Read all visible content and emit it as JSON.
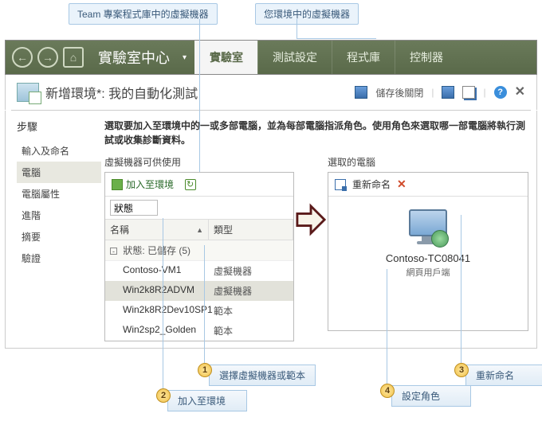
{
  "top_callouts": {
    "left": "Team 專案程式庫中的虛擬機器",
    "right": "您環境中的虛擬機器"
  },
  "ribbon": {
    "title": "實驗室中心",
    "tabs": [
      "實驗室",
      "測試設定",
      "程式庫",
      "控制器"
    ],
    "active_index": 0
  },
  "subheader": {
    "title": "新增環境*: 我的自動化測試",
    "save_close": "儲存後關閉",
    "help_glyph": "?",
    "close_glyph": "✕"
  },
  "steps": {
    "title": "步驟",
    "items": [
      "輸入及命名",
      "電腦",
      "電腦屬性",
      "進階",
      "摘要",
      "驗證"
    ],
    "active_index": 1
  },
  "content": {
    "description": "選取要加入至環境中的一或多部電腦，並為每部電腦指派角色。使用角色來選取哪一部電腦將執行測試或收集診斷資料。",
    "left_panel": {
      "title": "虛擬機器可供使用",
      "add_btn": "加入至環境",
      "filter_label": "狀態",
      "col_name": "名稱",
      "col_type": "類型",
      "group_label": "狀態: 已儲存 (5)",
      "rows": [
        {
          "name": "Contoso-VM1",
          "type": "虛擬機器"
        },
        {
          "name": "Win2k8R2ADVM",
          "type": "虛擬機器"
        },
        {
          "name": "Win2k8R2Dev10SP1",
          "type": "範本"
        },
        {
          "name": "Win2sp2_Golden",
          "type": "範本"
        }
      ],
      "selected_index": 1
    },
    "right_panel": {
      "title": "選取的電腦",
      "rename_btn": "重新命名",
      "computer_name": "Contoso-TC08041",
      "computer_role": "網頁用戶端"
    }
  },
  "bottom_callouts": {
    "c1": {
      "num": "1",
      "label": "選擇虛擬機器或範本"
    },
    "c2": {
      "num": "2",
      "label": "加入至環境"
    },
    "c3": {
      "num": "3",
      "label": "重新命名"
    },
    "c4": {
      "num": "4",
      "label": "設定角色"
    }
  }
}
